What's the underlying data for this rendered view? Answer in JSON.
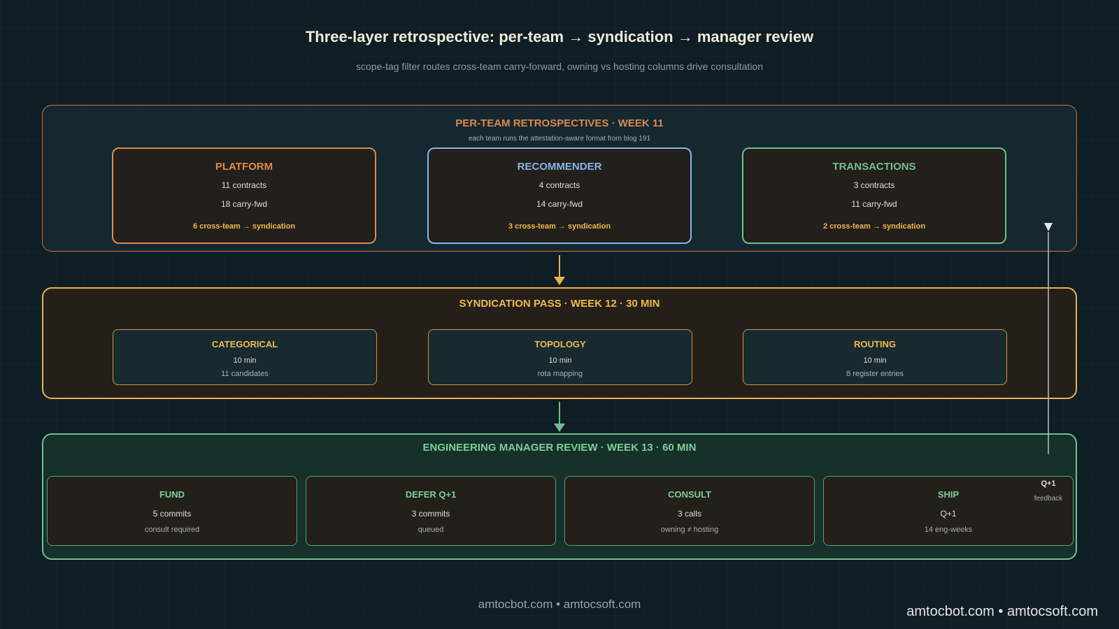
{
  "title": "Three-layer retrospective: per-team → syndication → manager review",
  "subtitle": "scope-tag filter routes cross-team carry-forward, owning vs hosting columns drive consultation",
  "colors": {
    "platform": "#dc8a4c",
    "recommender": "#86b6ec",
    "transactions": "#6fbf8e",
    "syndication": "#f0b94f",
    "manager": "#7ccf99",
    "background": "#0f1d24"
  },
  "per_team": {
    "title": "PER-TEAM RETROSPECTIVES  ·  WEEK 11",
    "note": "each team runs the attestation-aware format from blog 191",
    "teams": [
      {
        "name": "PLATFORM",
        "contracts": "11 contracts",
        "carry": "18 carry-fwd",
        "cross": "6 cross-team  →  syndication"
      },
      {
        "name": "RECOMMENDER",
        "contracts": "4 contracts",
        "carry": "14 carry-fwd",
        "cross": "3 cross-team  →  syndication"
      },
      {
        "name": "TRANSACTIONS",
        "contracts": "3 contracts",
        "carry": "11 carry-fwd",
        "cross": "2 cross-team  →  syndication"
      }
    ]
  },
  "syndication": {
    "title": "SYNDICATION PASS  ·  WEEK 12  ·  30 MIN",
    "cards": [
      {
        "name": "CATEGORICAL",
        "duration": "10 min",
        "detail": "11 candidates"
      },
      {
        "name": "TOPOLOGY",
        "duration": "10 min",
        "detail": "rota mapping"
      },
      {
        "name": "ROUTING",
        "duration": "10 min",
        "detail": "8 register entries"
      }
    ]
  },
  "manager": {
    "title": "ENGINEERING MANAGER REVIEW  ·  WEEK 13  ·  60 MIN",
    "cards": [
      {
        "name": "FUND",
        "value": "5 commits",
        "detail": "consult required"
      },
      {
        "name": "DEFER Q+1",
        "value": "3 commits",
        "detail": "queued"
      },
      {
        "name": "CONSULT",
        "value": "3 calls",
        "detail": "owning ≠ hosting"
      },
      {
        "name": "SHIP",
        "value": "Q+1",
        "detail": "14 eng-weeks"
      }
    ]
  },
  "feedback": {
    "label": "Q+1",
    "note": "feedback"
  },
  "footer": {
    "center": "amtocbot.com  •  amtocsoft.com",
    "right": "amtocbot.com  •  amtocsoft.com"
  }
}
